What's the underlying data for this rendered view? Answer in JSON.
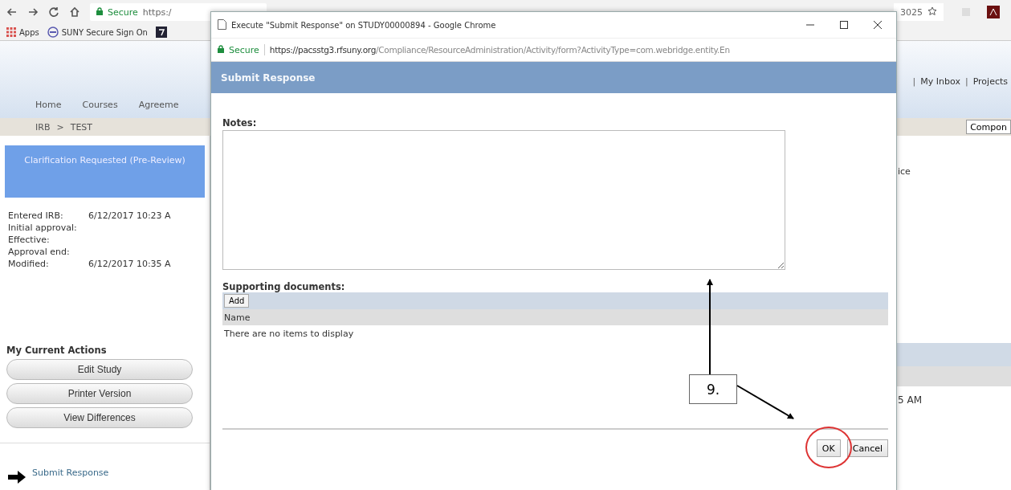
{
  "browser": {
    "secure": "Secure",
    "url": "https:/",
    "url_tail": "3025",
    "bookmarks": [
      {
        "kind": "apps",
        "label": "Apps"
      },
      {
        "kind": "site",
        "label": "SUNY Secure Sign On"
      },
      {
        "kind": "tile"
      }
    ]
  },
  "page": {
    "nav": [
      "Home",
      "Courses",
      "Agreeme"
    ],
    "separator": "|",
    "top_links": [
      "My Inbox",
      "Projects"
    ],
    "breadcrumb": [
      "IRB",
      "TEST"
    ],
    "breadcrumb_separator": ">",
    "component_button": "Compon",
    "status": "Clarification Requested (Pre-Review)",
    "details": [
      {
        "label": "Entered IRB:",
        "value": "6/12/2017 10:23 A"
      },
      {
        "label": "Initial approval:"
      },
      {
        "label": "Effective:"
      },
      {
        "label": "Approval end:"
      },
      {
        "label": "Modified:",
        "value": "6/12/2017 10:35 A"
      }
    ],
    "actions_title": "My Current Actions",
    "actions": [
      "Edit Study",
      "Printer Version",
      "View Differences"
    ],
    "submit_link": "Submit Response",
    "right_text": "ice",
    "right_time": "5 AM"
  },
  "popup": {
    "title": "Execute \"Submit Response\" on STUDY00000894 - Google Chrome",
    "secure": "Secure",
    "url_host": "https://pacsstg3.rfsuny.org",
    "url_path": "/Compliance/ResourceAdministration/Activity/form?ActivityType=com.webridge.entity.En",
    "header": "Submit Response",
    "notes_label": "Notes:",
    "documents_label": "Supporting documents:",
    "add_button": "Add",
    "column": "Name",
    "empty_message": "There are no items to display",
    "buttons": [
      {
        "label": "OK",
        "highlighted": true
      },
      {
        "label": "Cancel",
        "highlighted": false
      }
    ]
  },
  "annotation": {
    "label": "9."
  }
}
